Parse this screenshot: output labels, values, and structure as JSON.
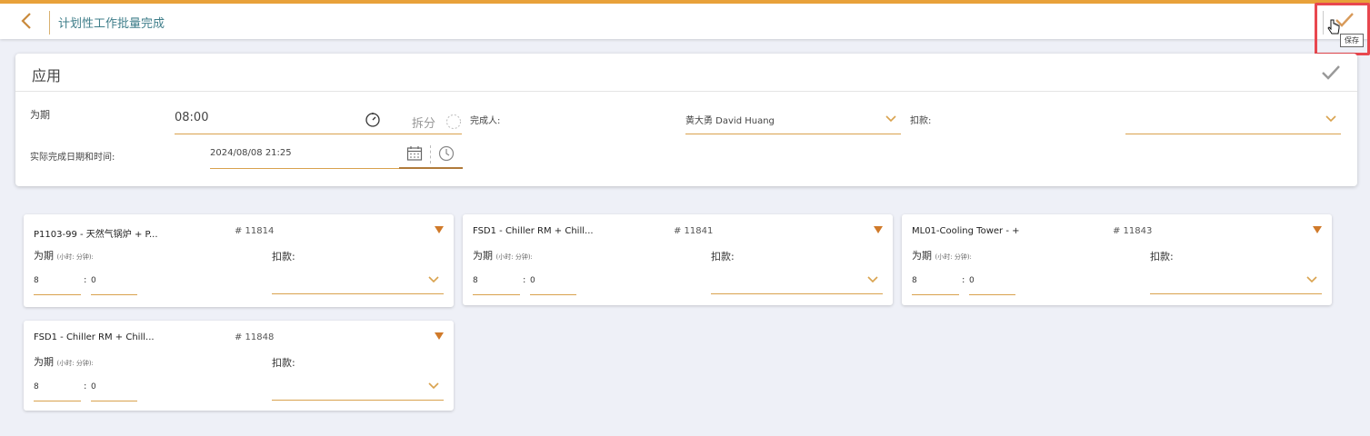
{
  "header": {
    "title": "计划性工作批量完成",
    "save_tooltip": "保存"
  },
  "apply": {
    "title": "应用",
    "duration_label": "为期",
    "duration_value": "08:00",
    "split_label": "拆分",
    "completed_by_label": "完成人:",
    "completed_by_value": "黄大勇 David Huang",
    "deduction_label": "扣款:",
    "deduction_value": "",
    "actual_datetime_label": "实际完成日期和时间:",
    "actual_datetime_value": "2024/08/08 21:25"
  },
  "work_orders": [
    {
      "title": "P1103-99 - 天然气锅炉 + P...",
      "number": "# 11814",
      "duration_label": "为期",
      "unit_label": "(小时: 分钟):",
      "deduction_label": "扣款:",
      "hours": "8",
      "colon": ":",
      "minutes": "0"
    },
    {
      "title": "FSD1 - Chiller RM + Chill...",
      "number": "# 11841",
      "duration_label": "为期",
      "unit_label": "(小时: 分钟):",
      "deduction_label": "扣款:",
      "hours": "8",
      "colon": ":",
      "minutes": "0"
    },
    {
      "title": "ML01-Cooling Tower - +",
      "number": "# 11843",
      "duration_label": "为期",
      "unit_label": "(小时: 分钟):",
      "deduction_label": "扣款:",
      "hours": "8",
      "colon": ":",
      "minutes": "0"
    },
    {
      "title": "FSD1 - Chiller RM + Chill...",
      "number": "# 11848",
      "duration_label": "为期",
      "unit_label": "(小时: 分钟):",
      "deduction_label": "扣款:",
      "hours": "8",
      "colon": ":",
      "minutes": "0"
    }
  ],
  "colors": {
    "accent": "#e8a13a",
    "field_underline": "#d9a24e",
    "title_teal": "#3f7e8a",
    "highlight_red": "#e8474f"
  },
  "icons": [
    "back-arrow-icon",
    "check-icon",
    "cursor-hand-icon",
    "timer-icon",
    "split-toggle-icon",
    "calendar-icon",
    "clock-icon",
    "chevron-down-icon",
    "triangle-down-icon"
  ]
}
